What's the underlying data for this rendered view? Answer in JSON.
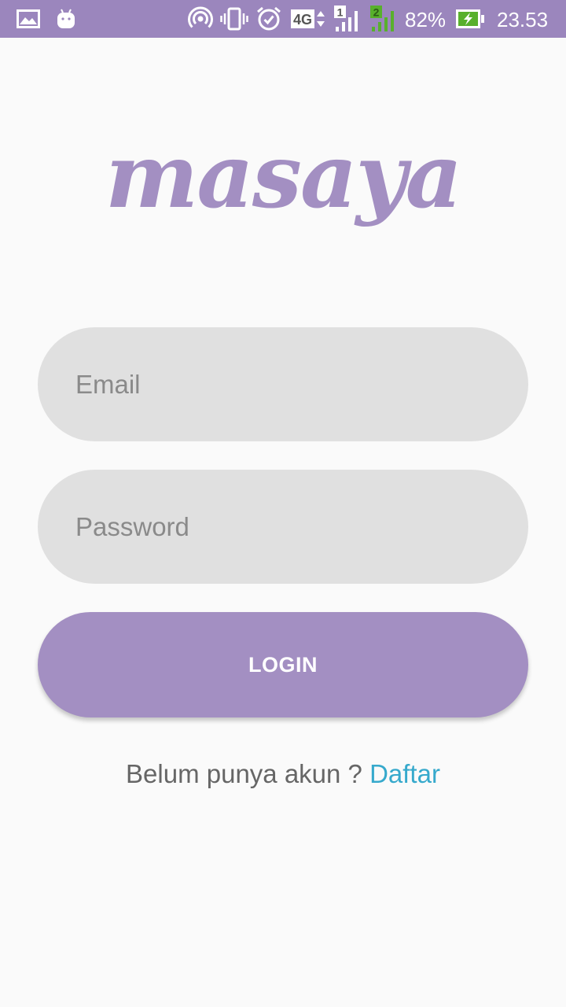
{
  "status_bar": {
    "battery_percent": "82%",
    "time": "23.53",
    "network_type": "4G",
    "sim1_label": "1",
    "sim2_label": "2",
    "icons": [
      "gallery-icon",
      "android-icon",
      "hotspot-icon",
      "vibrate-icon",
      "alarm-icon",
      "network-4g-icon",
      "signal-sim1-icon",
      "signal-sim2-icon",
      "battery-charging-icon"
    ]
  },
  "logo": {
    "text": "masaya",
    "color": "#a38fc2"
  },
  "login_form": {
    "email_placeholder": "Email",
    "email_value": "",
    "password_placeholder": "Password",
    "password_value": "",
    "login_label": "LOGIN"
  },
  "register": {
    "prompt": "Belum punya akun ? ",
    "link_label": "Daftar"
  },
  "colors": {
    "status_bar": "#9b86bd",
    "accent": "#a38fc2",
    "input_bg": "#e0e0e0",
    "link": "#36a9cc",
    "background": "#fafafa"
  }
}
